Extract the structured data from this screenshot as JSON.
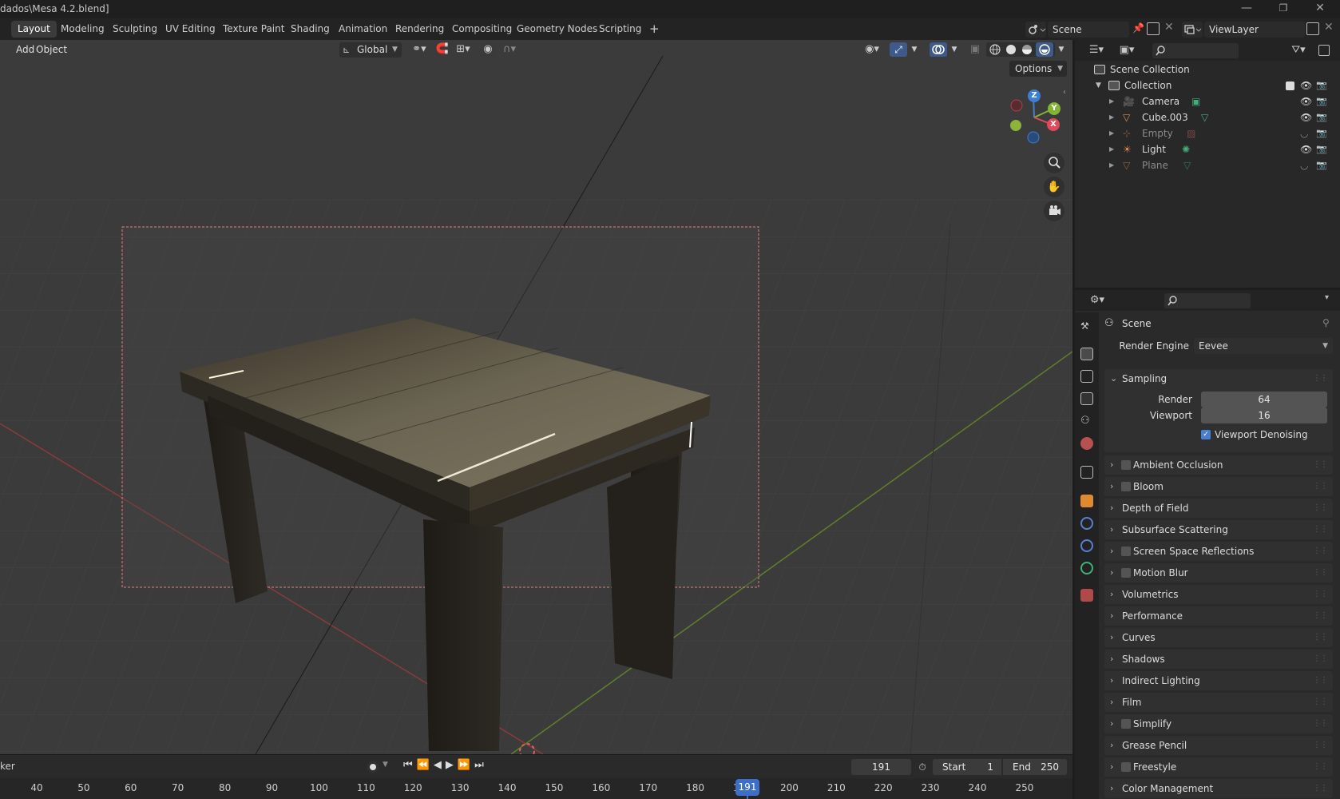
{
  "window": {
    "title": "dados\\Mesa 4.2.blend]",
    "controls": [
      "—",
      "❐",
      "✕"
    ]
  },
  "workspaces": [
    {
      "label": "Layout",
      "active": true
    },
    {
      "label": "Modeling"
    },
    {
      "label": "Sculpting"
    },
    {
      "label": "UV Editing"
    },
    {
      "label": "Texture Paint"
    },
    {
      "label": "Shading"
    },
    {
      "label": "Animation"
    },
    {
      "label": "Rendering"
    },
    {
      "label": "Compositing"
    },
    {
      "label": "Geometry Nodes"
    },
    {
      "label": "Scripting"
    },
    {
      "label": "+"
    }
  ],
  "topbar": {
    "scene_name": "Scene",
    "view_layer_name": "ViewLayer"
  },
  "viewport": {
    "menu_add": "Add",
    "menu_object": "Object",
    "transform_orientation": "Global",
    "options_label": "Options",
    "gizmo_axes": {
      "z": "Z",
      "y": "Y",
      "x": "X"
    },
    "colors": {
      "background": "#3d3d3d",
      "camera_frame": "#e07070",
      "x_axis": "#b34a4a",
      "y_axis": "#6a8f2e"
    }
  },
  "timeline": {
    "label": "ker",
    "current_frame": "191",
    "start_label": "Start",
    "start_value": "1",
    "end_label": "End",
    "end_value": "250",
    "frame_numbers": [
      "40",
      "50",
      "60",
      "70",
      "80",
      "90",
      "100",
      "110",
      "120",
      "130",
      "140",
      "150",
      "160",
      "170",
      "180",
      "190",
      "200",
      "210",
      "220",
      "230",
      "240",
      "250"
    ],
    "playhead": "191"
  },
  "outliner": {
    "root": "Scene Collection",
    "collection": "Collection",
    "items": [
      {
        "name": "Camera",
        "icon": "camera-icon",
        "data_icon": "camera-data-icon",
        "visible": true
      },
      {
        "name": "Cube.003",
        "icon": "mesh-icon",
        "data_icon": "mesh-data-icon",
        "visible": true
      },
      {
        "name": "Empty",
        "icon": "empty-icon",
        "data_icon": "image-data-icon",
        "visible": false
      },
      {
        "name": "Light",
        "icon": "light-icon",
        "data_icon": "light-data-icon",
        "visible": true
      },
      {
        "name": "Plane",
        "icon": "mesh-icon",
        "data_icon": "mesh-data-icon",
        "visible": false
      }
    ]
  },
  "properties": {
    "context": "Scene",
    "render_engine_label": "Render Engine",
    "render_engine_value": "Eevee",
    "sampling": {
      "title": "Sampling",
      "render_label": "Render",
      "render_value": "64",
      "viewport_label": "Viewport",
      "viewport_value": "16",
      "denoise_label": "Viewport Denoising",
      "denoise_checked": true
    },
    "panels": [
      {
        "label": "Ambient Occlusion",
        "checkbox": true
      },
      {
        "label": "Bloom",
        "checkbox": true
      },
      {
        "label": "Depth of Field",
        "checkbox": false
      },
      {
        "label": "Subsurface Scattering",
        "checkbox": false
      },
      {
        "label": "Screen Space Reflections",
        "checkbox": true
      },
      {
        "label": "Motion Blur",
        "checkbox": true
      },
      {
        "label": "Volumetrics",
        "checkbox": false
      },
      {
        "label": "Performance",
        "checkbox": false
      },
      {
        "label": "Curves",
        "checkbox": false
      },
      {
        "label": "Shadows",
        "checkbox": false
      },
      {
        "label": "Indirect Lighting",
        "checkbox": false
      },
      {
        "label": "Film",
        "checkbox": false
      },
      {
        "label": "Simplify",
        "checkbox": true
      },
      {
        "label": "Grease Pencil",
        "checkbox": false
      },
      {
        "label": "Freestyle",
        "checkbox": true
      },
      {
        "label": "Color Management",
        "checkbox": false
      }
    ],
    "tabs": [
      "tool",
      "render",
      "output",
      "view-layer",
      "scene",
      "world",
      "collection",
      "object",
      "modifiers",
      "physics",
      "constraints",
      "data",
      "texture"
    ]
  }
}
